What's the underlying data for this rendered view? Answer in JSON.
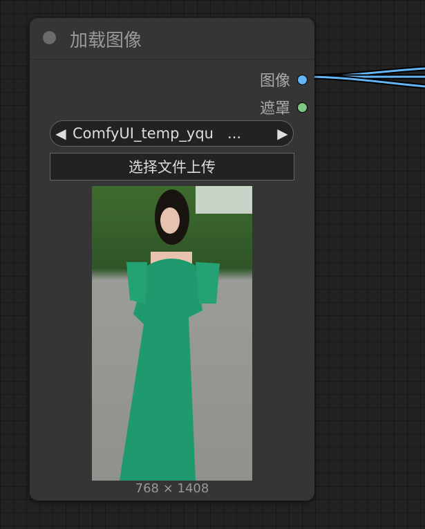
{
  "node": {
    "title": "加载图像",
    "outputs": [
      {
        "label": "图像",
        "color": "#64b5f6"
      },
      {
        "label": "遮罩",
        "color": "#81c784"
      }
    ],
    "image_combo": {
      "value": "ComfyUI_temp_yqu   ...",
      "prev_icon": "◀",
      "next_icon": "▶"
    },
    "upload_button": "选择文件上传",
    "preview_size": "768 × 1408"
  }
}
